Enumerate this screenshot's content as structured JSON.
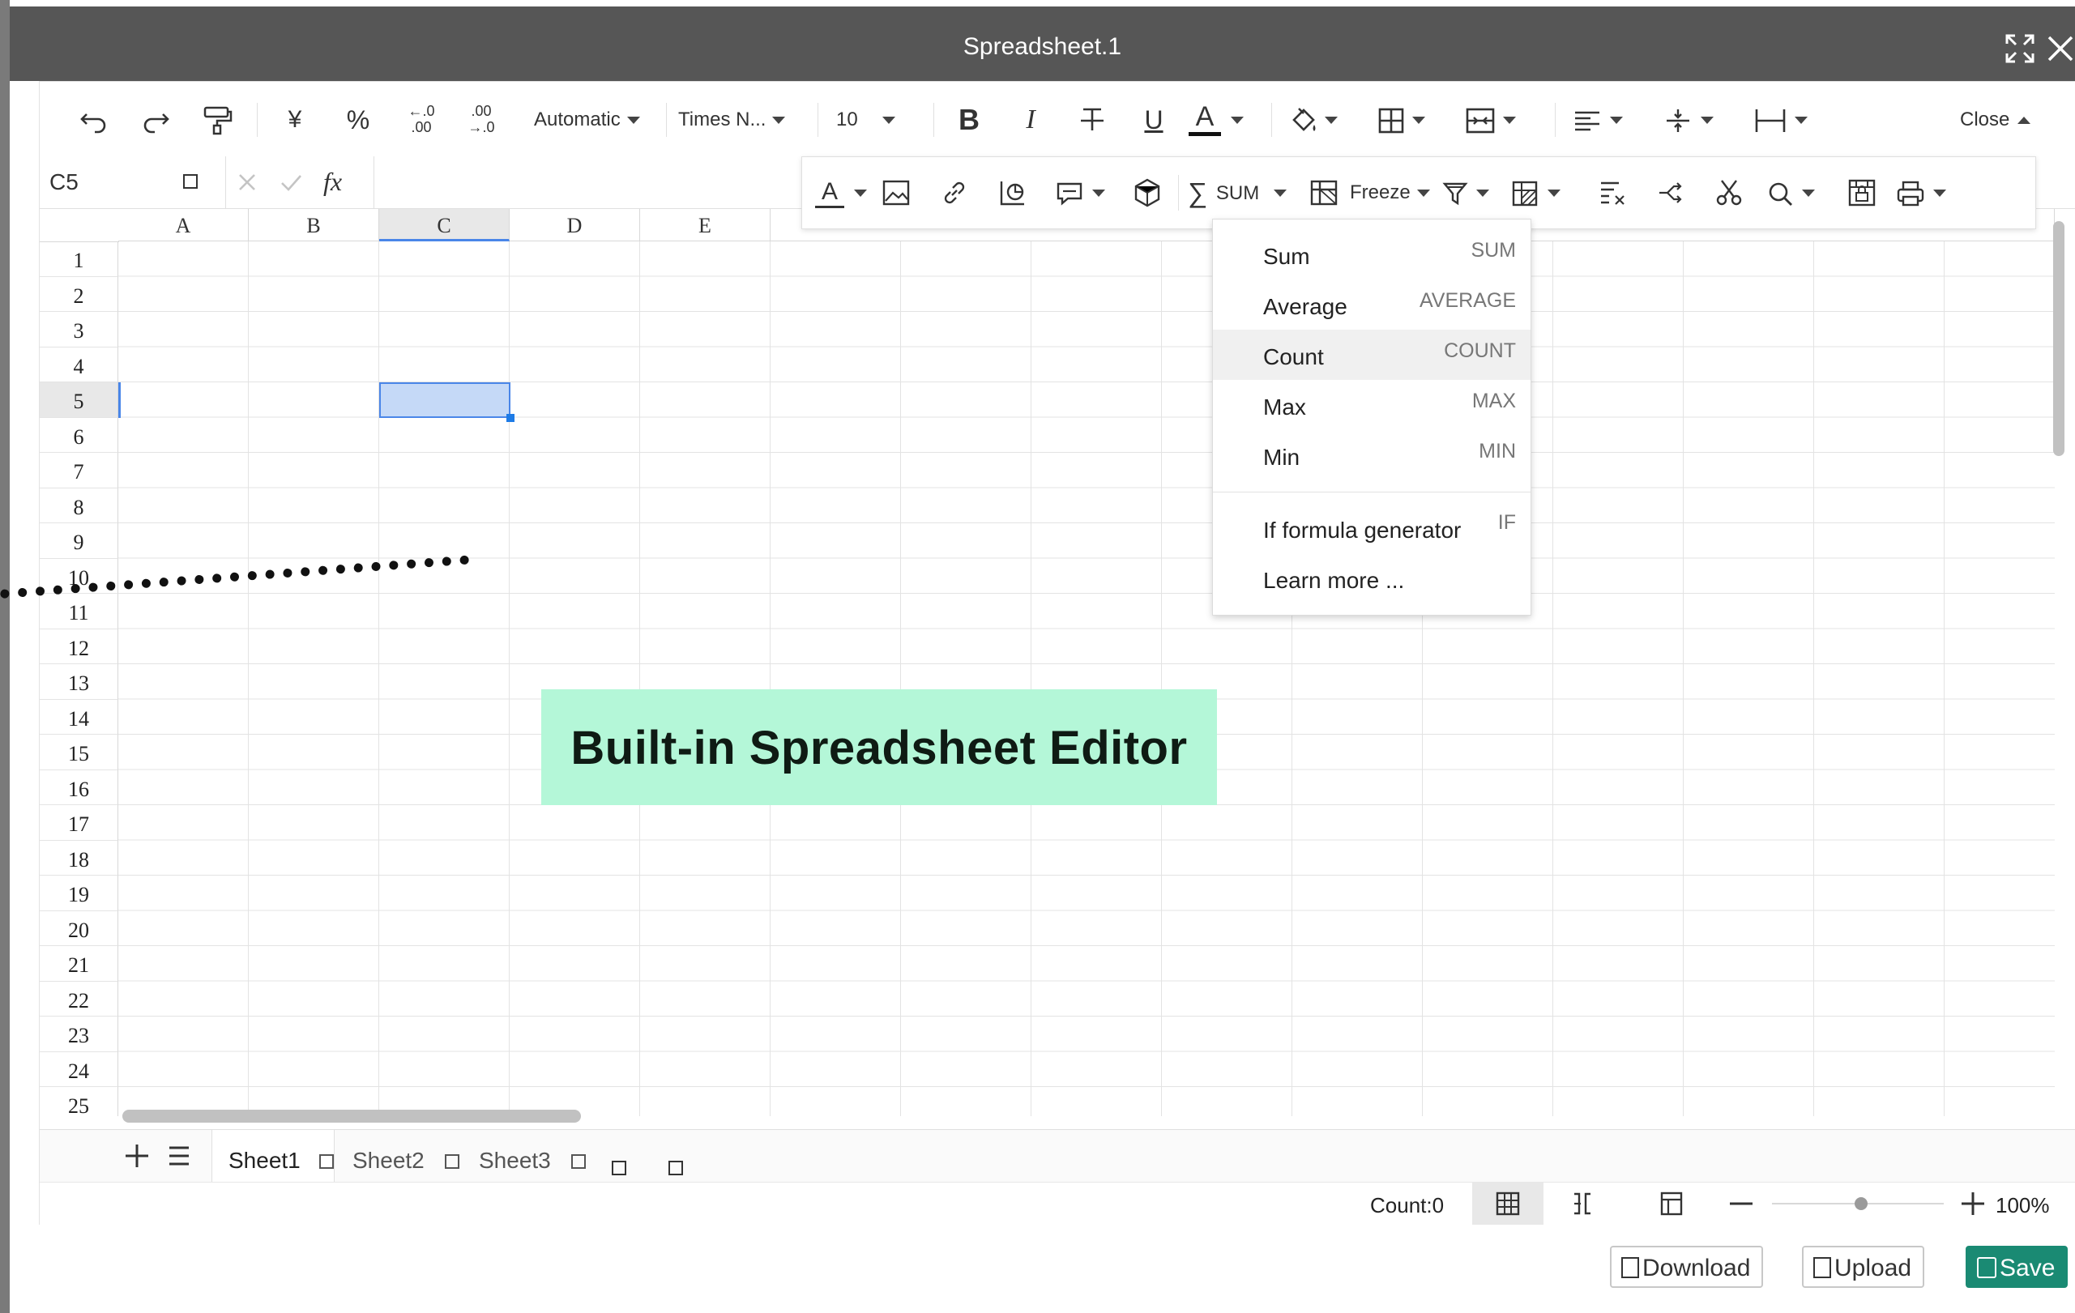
{
  "window": {
    "title": "Spreadsheet.1"
  },
  "toolbar": {
    "number_format": "Automatic",
    "currency_symbol": "¥",
    "percent_symbol": "%",
    "decimal_increase": ".00",
    "decimal_decrease": ".0",
    "font_family": "Times N...",
    "font_size": "10",
    "bold": "B",
    "italic": "I",
    "underline": "U",
    "font_color": "A",
    "close_label": "Close"
  },
  "formula_bar": {
    "cell_ref": "C5",
    "fx": "fx"
  },
  "toolbar2": {
    "text_color": "A",
    "sum_label": "SUM",
    "freeze_label": "Freeze"
  },
  "columns": [
    "A",
    "B",
    "C",
    "D",
    "E"
  ],
  "rows": [
    "1",
    "2",
    "3",
    "4",
    "5",
    "6",
    "7",
    "8",
    "9",
    "10",
    "11",
    "12",
    "13",
    "14",
    "15",
    "16",
    "17",
    "18",
    "19",
    "20",
    "21",
    "22",
    "23",
    "24",
    "25"
  ],
  "sum_menu": {
    "items": [
      {
        "label": "Sum",
        "shortcut": "SUM"
      },
      {
        "label": "Average",
        "shortcut": "AVERAGE"
      },
      {
        "label": "Count",
        "shortcut": "COUNT"
      },
      {
        "label": "Max",
        "shortcut": "MAX"
      },
      {
        "label": "Min",
        "shortcut": "MIN"
      },
      {
        "label": "If formula generator",
        "shortcut": "IF"
      },
      {
        "label": "Learn more ...",
        "shortcut": ""
      }
    ]
  },
  "sheets": [
    "Sheet1",
    "Sheet2",
    "Sheet3"
  ],
  "status": {
    "count": "Count:0",
    "zoom": "100%",
    "zoom_level": 0.52
  },
  "banner": {
    "text": "Built-in Spreadsheet Editor"
  },
  "buttons": {
    "download": "Download",
    "upload": "Upload",
    "save": "Save"
  },
  "colors": {
    "titlebar": "#565656",
    "selection": "#c5d9f7",
    "selection_border": "#4a86e8",
    "banner": "#b4f7d8",
    "save": "#1a8a73"
  }
}
